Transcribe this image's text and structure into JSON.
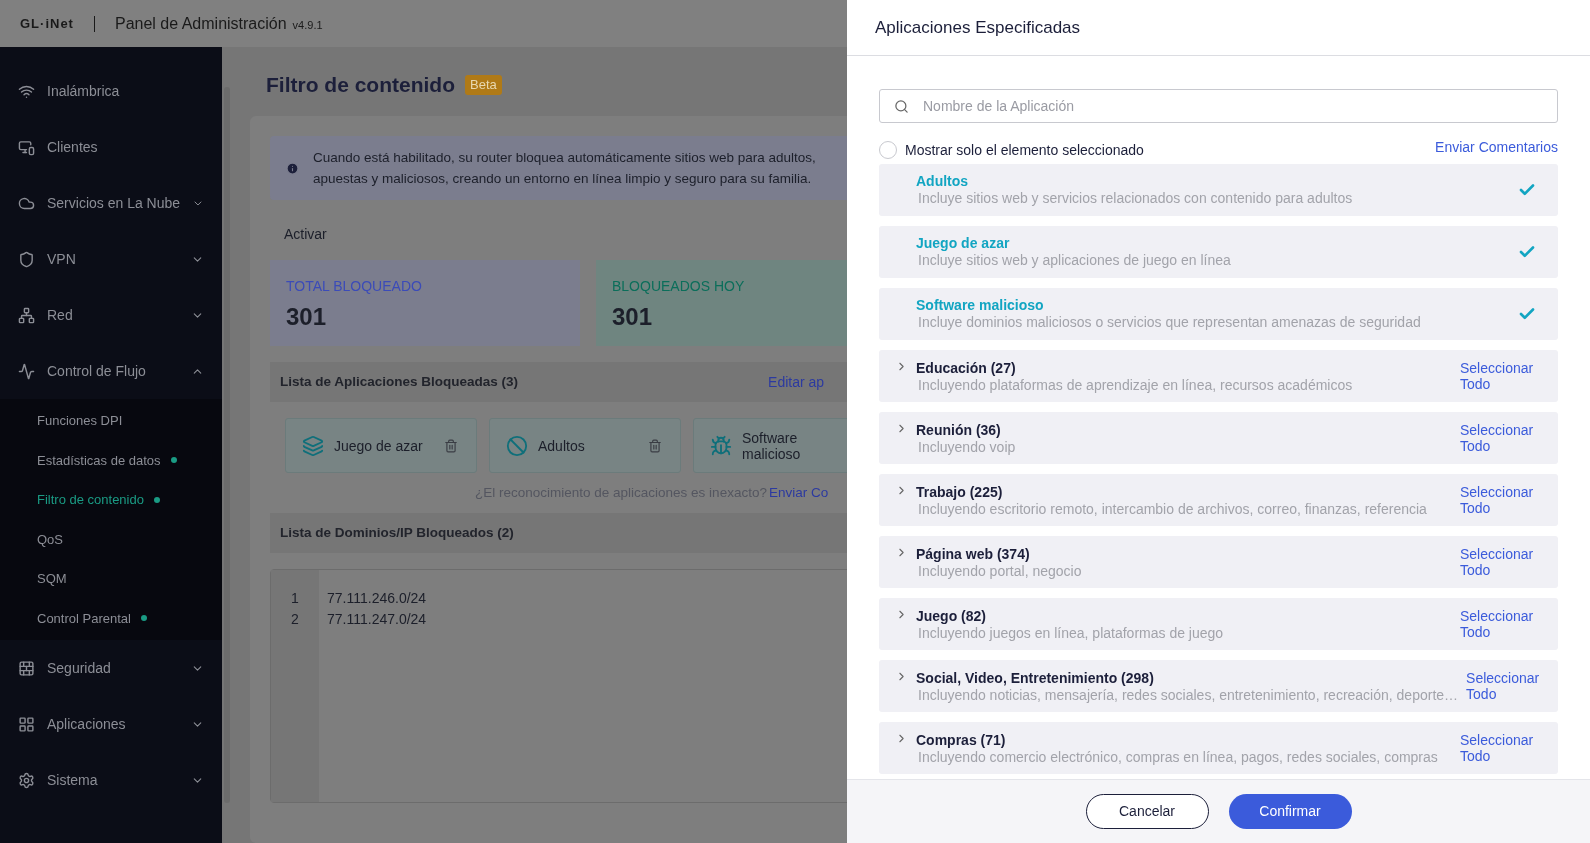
{
  "header": {
    "logo": "GL·iNet",
    "title": "Panel de Administración",
    "version": "v4.9.1"
  },
  "sidebar": {
    "items": [
      {
        "label": "Inalámbrica",
        "expandable": false
      },
      {
        "label": "Clientes",
        "expandable": false
      },
      {
        "label": "Servicios en La Nube",
        "expandable": true,
        "expanded": false
      },
      {
        "label": "VPN",
        "expandable": true,
        "expanded": false
      },
      {
        "label": "Red",
        "expandable": true,
        "expanded": false
      },
      {
        "label": "Control de Flujo",
        "expandable": true,
        "expanded": true,
        "children": [
          {
            "label": "Funciones DPI",
            "selected": false,
            "dot": false
          },
          {
            "label": "Estadísticas de datos",
            "selected": false,
            "dot": true
          },
          {
            "label": "Filtro de contenido",
            "selected": true,
            "dot": true
          },
          {
            "label": "QoS",
            "selected": false,
            "dot": false
          },
          {
            "label": "SQM",
            "selected": false,
            "dot": false
          },
          {
            "label": "Control Parental",
            "selected": false,
            "dot": true
          }
        ]
      },
      {
        "label": "Seguridad",
        "expandable": true,
        "expanded": false
      },
      {
        "label": "Aplicaciones",
        "expandable": true,
        "expanded": false
      },
      {
        "label": "Sistema",
        "expandable": true,
        "expanded": false
      }
    ]
  },
  "page": {
    "title": "Filtro de contenido",
    "badge": "Beta",
    "info": [
      "Cuando está habilitado, su router bloquea automáticamente sitios web para adultos,",
      "apuestas y maliciosos, creando un entorno en línea limpio y seguro para su familia."
    ],
    "enable_label": "Activar",
    "stats": [
      {
        "label": "TOTAL BLOQUEADO",
        "value": "301",
        "color": "#3b4bb8"
      },
      {
        "label": "BLOQUEADOS HOY",
        "value": "301",
        "color": "#0b6e5a"
      }
    ],
    "apps_section": {
      "title": "Lista de Aplicaciones Bloqueadas (3)",
      "link": "Editar ap"
    },
    "blocked_apps": [
      {
        "name": "Juego de azar",
        "deletable": true
      },
      {
        "name": "Adultos",
        "deletable": true
      },
      {
        "name": "Software malicioso"
      }
    ],
    "feedback": {
      "text": "¿El reconocimiento de aplicaciones es inexacto?",
      "link": "Enviar Co"
    },
    "domains_section": {
      "title": "Lista de Dominios/IP Bloqueados (2)"
    },
    "domains": [
      {
        "line": "1",
        "value": "77.111.246.0/24"
      },
      {
        "line": "2",
        "value": "77.111.247.0/24"
      }
    ]
  },
  "drawer": {
    "title": "Aplicaciones Especificadas",
    "search": {
      "placeholder": "Nombre de la Aplicación"
    },
    "show_selected": {
      "label": "Mostrar solo el elemento seleccionado",
      "checked": false
    },
    "feedback_link": "Enviar Comentarios",
    "items": [
      {
        "kind": "app",
        "name": "Adultos",
        "description": "Incluye sitios web y servicios relacionados con contenido para adultos",
        "checked": true
      },
      {
        "kind": "app",
        "name": "Juego de azar",
        "description": "Incluye sitios web y aplicaciones de juego en línea",
        "checked": true
      },
      {
        "kind": "app",
        "name": "Software malicioso",
        "description": "Incluye dominios maliciosos o servicios que representan amenazas de seguridad",
        "checked": true
      },
      {
        "kind": "group",
        "name": "Educación (27)",
        "description": "Incluyendo plataformas de aprendizaje en línea, recursos académicos",
        "action": [
          "Seleccionar",
          "Todo"
        ],
        "expanded": false
      },
      {
        "kind": "group",
        "name": "Reunión (36)",
        "description": "Incluyendo voip",
        "action": [
          "Seleccionar",
          "Todo"
        ],
        "expanded": false
      },
      {
        "kind": "group",
        "name": "Trabajo (225)",
        "description": "Incluyendo escritorio remoto, intercambio de archivos, correo, finanzas, referencia",
        "action": [
          "Seleccionar",
          "Todo"
        ],
        "expanded": false
      },
      {
        "kind": "group",
        "name": "Página web (374)",
        "description": "Incluyendo portal, negocio",
        "action": [
          "Seleccionar",
          "Todo"
        ],
        "expanded": false
      },
      {
        "kind": "group",
        "name": "Juego (82)",
        "description": "Incluyendo juegos en línea, plataformas de juego",
        "action": [
          "Seleccionar",
          "Todo"
        ],
        "expanded": false
      },
      {
        "kind": "group",
        "name": "Social, Video, Entretenimiento (298)",
        "description": "Incluyendo noticias, mensajería, redes sociales, entretenimiento, recreación, deporte…",
        "action": [
          "Seleccionar",
          "Todo"
        ],
        "expanded": false
      },
      {
        "kind": "group",
        "name": "Compras (71)",
        "description": "Incluyendo comercio electrónico, compras en línea, pagos, redes sociales, compras",
        "action": [
          "Seleccionar",
          "Todo"
        ],
        "expanded": false
      }
    ],
    "buttons": [
      {
        "label": "Cancelar",
        "primary": false
      },
      {
        "label": "Confirmar",
        "primary": true
      }
    ]
  }
}
